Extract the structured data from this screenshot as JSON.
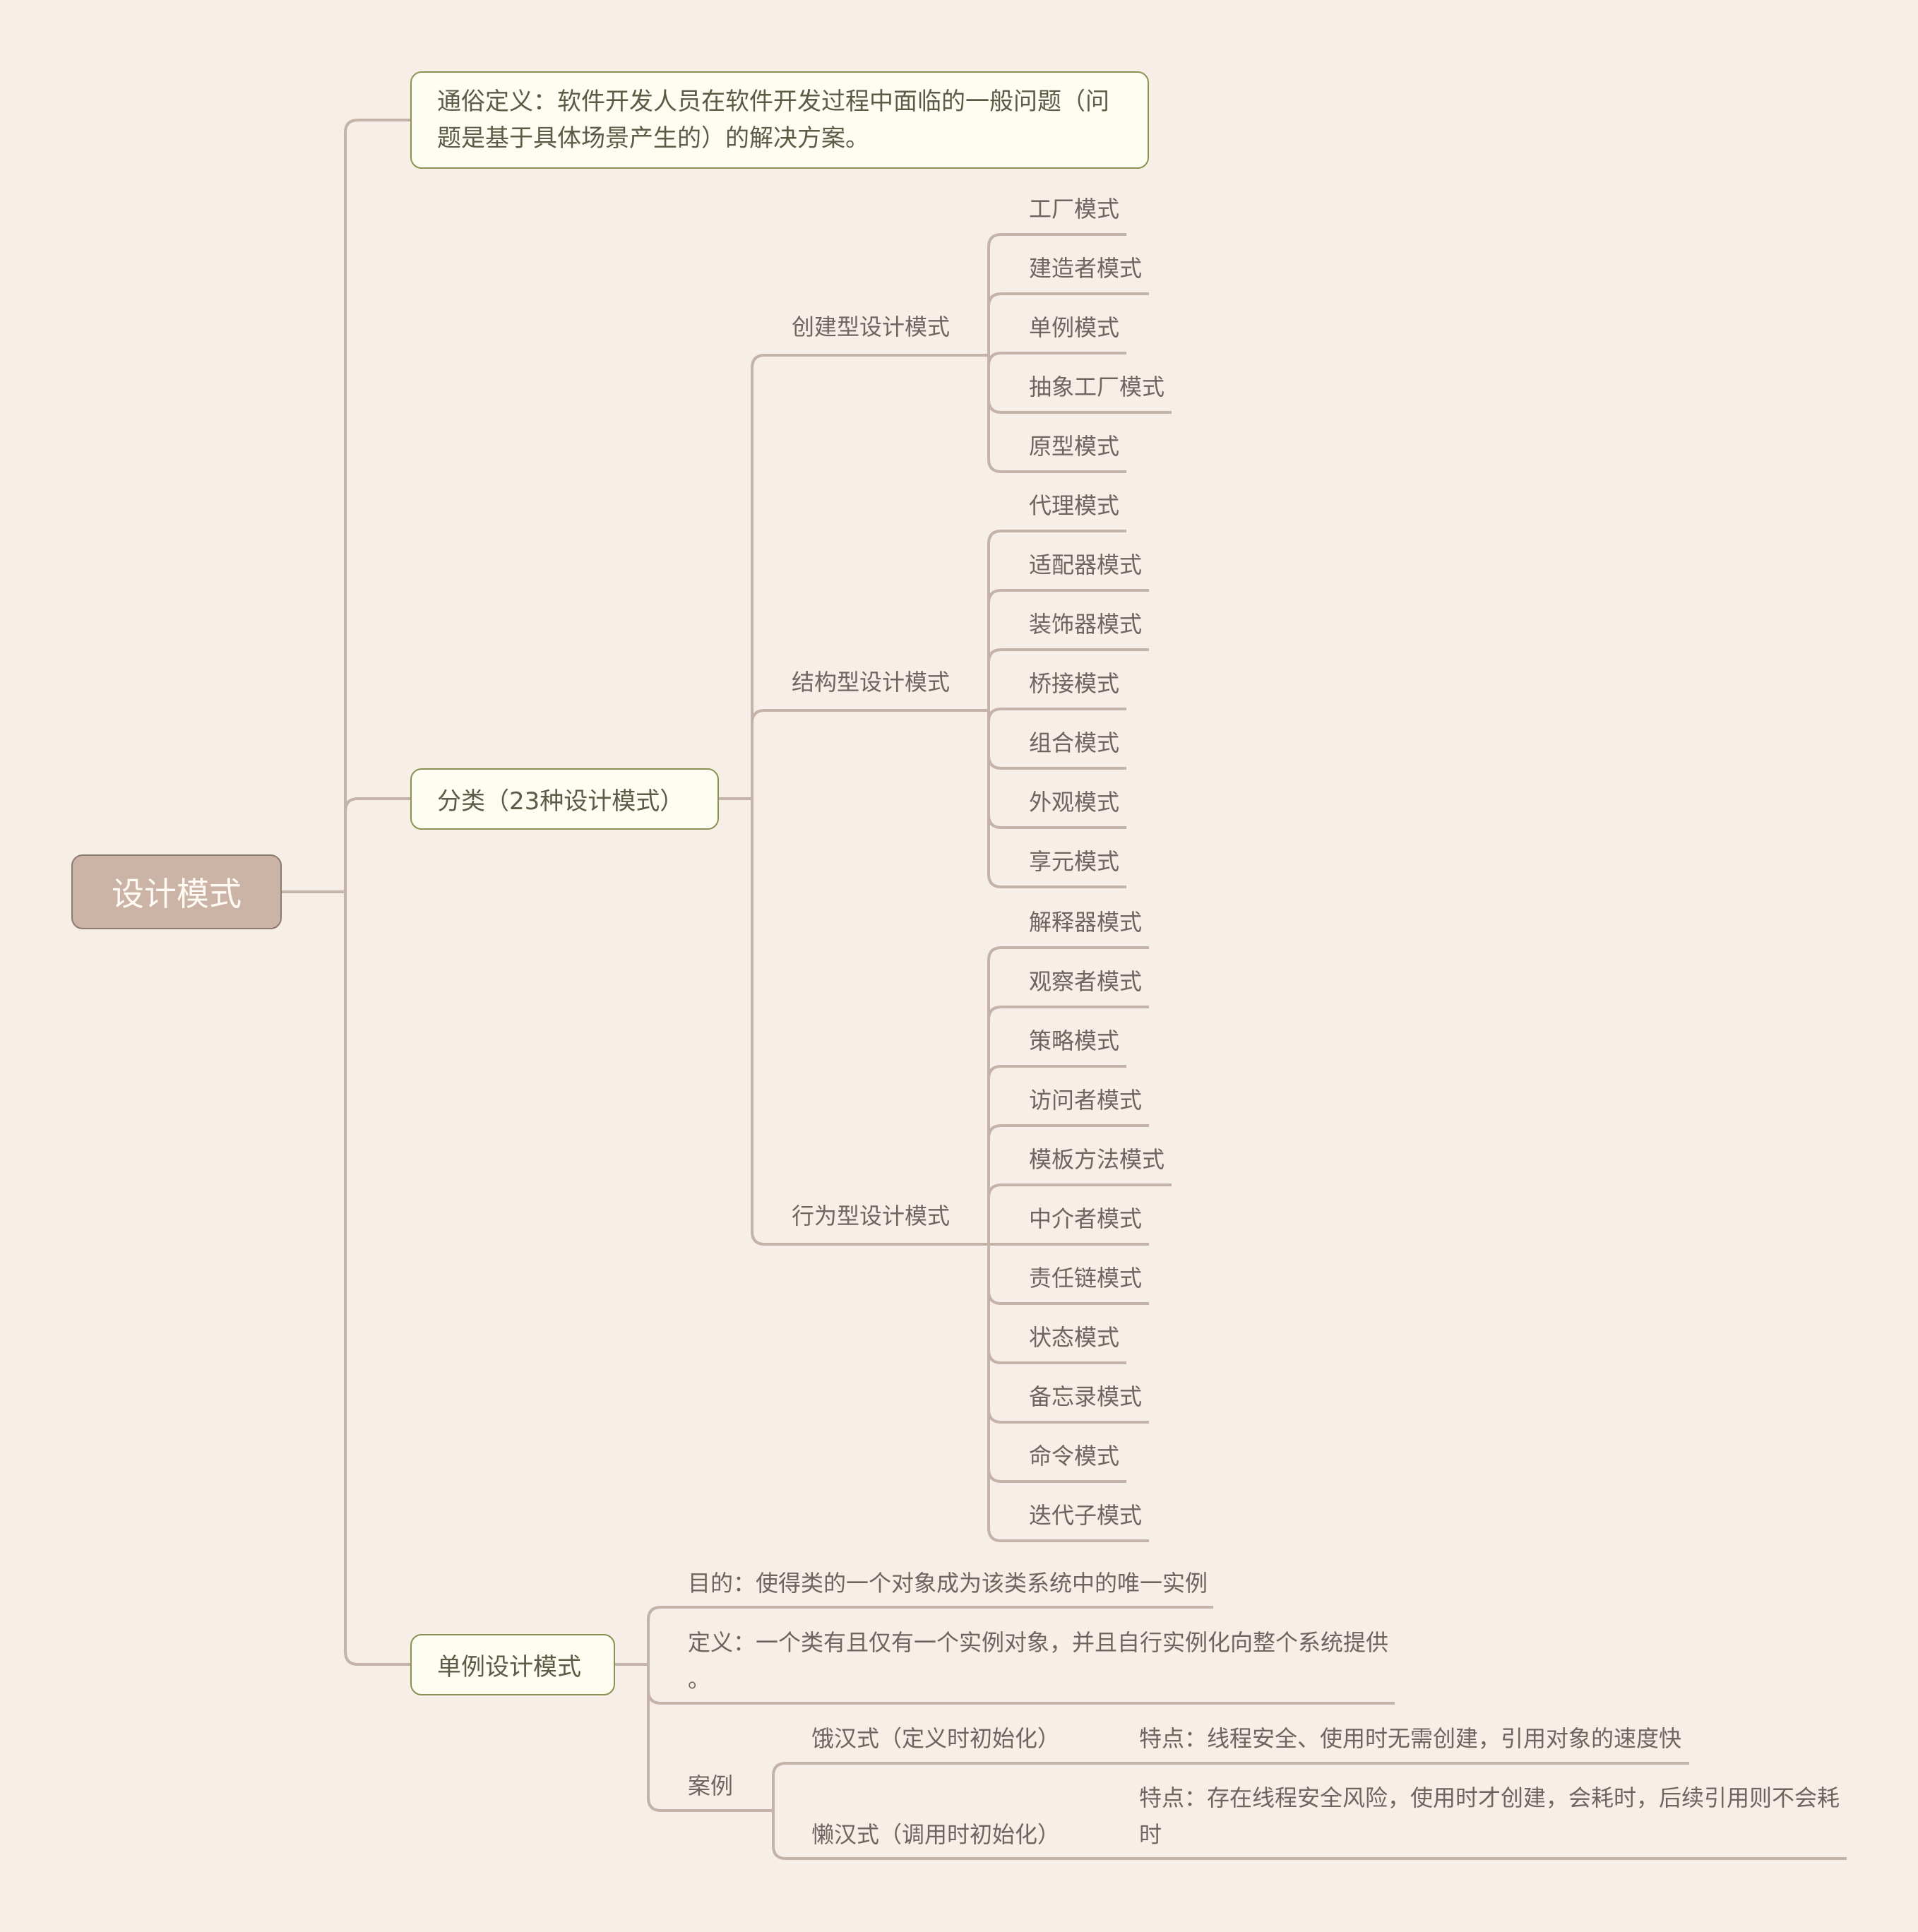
{
  "root": {
    "label": "设计模式"
  },
  "definition": {
    "label": "通俗定义：软件开发人员在软件开发过程中面临的一般问题（问题是基于具体场景产生的）的解决方案。"
  },
  "classification": {
    "label": "分类（23种设计模式）",
    "categories": [
      {
        "label": "创建型设计模式",
        "items": [
          "工厂模式",
          "建造者模式",
          "单例模式",
          "抽象工厂模式",
          "原型模式"
        ]
      },
      {
        "label": "结构型设计模式",
        "items": [
          "代理模式",
          "适配器模式",
          "装饰器模式",
          "桥接模式",
          "组合模式",
          "外观模式",
          "享元模式"
        ]
      },
      {
        "label": "行为型设计模式",
        "items": [
          "解释器模式",
          "观察者模式",
          "策略模式",
          "访问者模式",
          "模板方法模式",
          "中介者模式",
          "责任链模式",
          "状态模式",
          "备忘录模式",
          "命令模式",
          "迭代子模式"
        ]
      }
    ]
  },
  "singleton": {
    "label": "单例设计模式",
    "purpose": "目的：使得类的一个对象成为该类系统中的唯一实例",
    "definition_line1": "定义：一个类有且仅有一个实例对象，并且自行实例化向整个系统提供",
    "definition_line2": "。",
    "cases": {
      "label": "案例",
      "eager": {
        "label": "饿汉式（定义时初始化）",
        "feature": "特点：线程安全、使用时无需创建，引用对象的速度快"
      },
      "lazy": {
        "label": "懒汉式（调用时初始化）",
        "feature_line1": "特点：存在线程安全风险，使用时才创建，会耗时，后续引用则不会耗",
        "feature_line2": "时"
      }
    }
  }
}
